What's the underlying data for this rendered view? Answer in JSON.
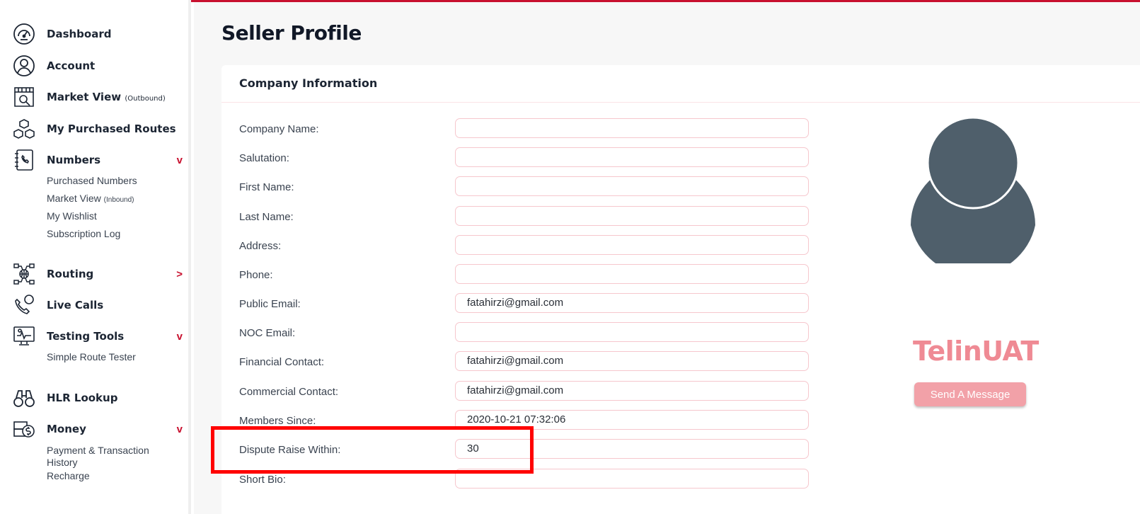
{
  "sidebar": {
    "dashboard": "Dashboard",
    "account": "Account",
    "market_view": "Market View",
    "market_view_note": "(Outbound)",
    "purchased_routes": "My Purchased Routes",
    "numbers": "Numbers",
    "numbers_arrow": "v",
    "numbers_sub": {
      "purchased_numbers": "Purchased Numbers",
      "market_view": "Market View",
      "market_view_note": "(Inbound)",
      "wishlist": "My Wishlist",
      "subscription_log": "Subscription Log"
    },
    "routing": "Routing",
    "routing_arrow": ">",
    "live_calls": "Live Calls",
    "testing_tools": "Testing Tools",
    "testing_arrow": "v",
    "testing_sub": {
      "simple_route_tester": "Simple Route Tester"
    },
    "hlr_lookup": "HLR Lookup",
    "money": "Money",
    "money_arrow": "v",
    "money_sub": {
      "payment_history_1": "Payment & Transaction",
      "payment_history_2": "History",
      "recharge": "Recharge"
    }
  },
  "page": {
    "title": "Seller Profile"
  },
  "card": {
    "title": "Company Information"
  },
  "form": [
    {
      "label": "Company Name:",
      "value": ""
    },
    {
      "label": "Salutation:",
      "value": ""
    },
    {
      "label": "First Name:",
      "value": ""
    },
    {
      "label": "Last Name:",
      "value": ""
    },
    {
      "label": "Address:",
      "value": ""
    },
    {
      "label": "Phone:",
      "value": ""
    },
    {
      "label": "Public Email:",
      "value": "fatahirzi@gmail.com"
    },
    {
      "label": "NOC Email:",
      "value": ""
    },
    {
      "label": "Financial Contact:",
      "value": "fatahirzi@gmail.com"
    },
    {
      "label": "Commercial Contact:",
      "value": "fatahirzi@gmail.com"
    },
    {
      "label": "Members Since:",
      "value": "2020-10-21 07:32:06"
    },
    {
      "label": "Dispute Raise Within:",
      "value": "30"
    },
    {
      "label": "Short Bio:",
      "value": ""
    }
  ],
  "profile": {
    "company": "TelinUAT",
    "send_message": "Send A Message"
  },
  "colors": {
    "brand_red": "#c8102e",
    "company_name": "#ef8a94",
    "button": "#f2a1a8",
    "avatar": "#4f5f6b",
    "highlight": "#ff0000"
  }
}
